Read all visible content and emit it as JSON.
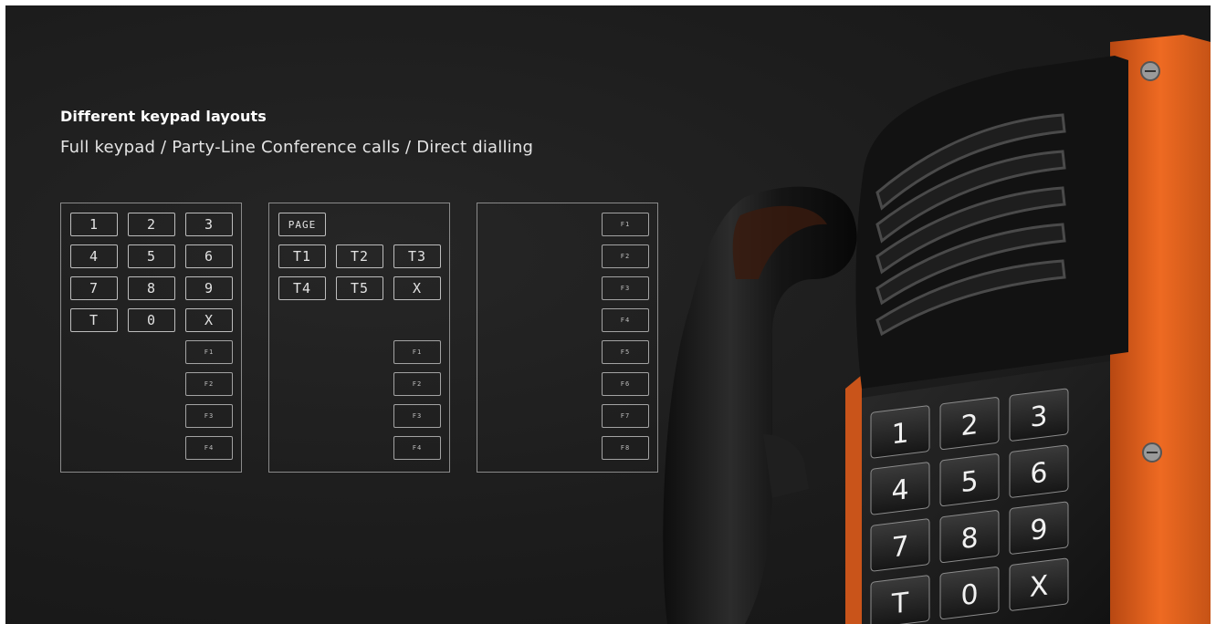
{
  "heading": "Different keypad layouts",
  "subheading": "Full keypad / Party-Line Conference calls / Direct dialling",
  "layouts": [
    {
      "digit_keys": [
        "1",
        "2",
        "3",
        "4",
        "5",
        "6",
        "7",
        "8",
        "9",
        "T",
        "0",
        "X"
      ],
      "function_keys": [
        "F1",
        "F2",
        "F3",
        "F4"
      ]
    },
    {
      "page_key": "PAGE",
      "party_keys": [
        "T1",
        "T2",
        "T3",
        "T4",
        "T5",
        "X"
      ],
      "function_keys": [
        "F1",
        "F2",
        "F3",
        "F4"
      ]
    },
    {
      "function_keys": [
        "F1",
        "F2",
        "F3",
        "F4",
        "F5",
        "F6",
        "F7",
        "F8"
      ]
    }
  ],
  "photo_keypad": [
    "1",
    "2",
    "3",
    "4",
    "5",
    "6",
    "7",
    "8",
    "9",
    "T",
    "0",
    "X"
  ],
  "colors": {
    "background": "#1c1c1c",
    "housing_orange": "#e8601c",
    "outline": "#bdbdbd",
    "text": "#ffffff"
  }
}
